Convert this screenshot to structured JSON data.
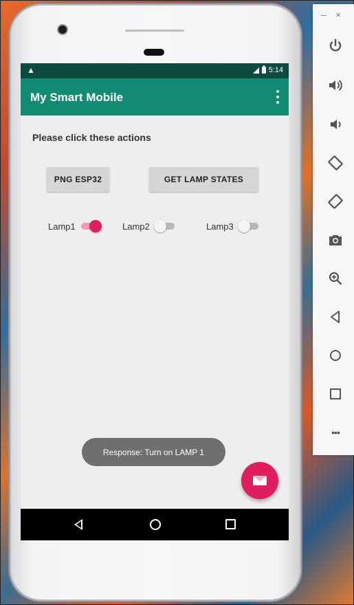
{
  "app": {
    "title": "My Smart Mobile",
    "status_time": "5:14",
    "status_alert": "▲"
  },
  "main": {
    "prompt": "Please click these actions",
    "buttons": {
      "ping_label": "PNG ESP32",
      "get_states_label": "GET LAMP STATES"
    },
    "lamps": [
      {
        "label": "Lamp1",
        "on": true
      },
      {
        "label": "Lamp2",
        "on": false
      },
      {
        "label": "Lamp3",
        "on": false
      }
    ]
  },
  "toast": "Response: Turn on LAMP 1",
  "emulator_panel": {
    "minimize": "–",
    "close": "×",
    "more": "•••",
    "tools": [
      "power-icon",
      "volume-up-icon",
      "volume-down-icon",
      "rotate-left-icon",
      "rotate-right-icon",
      "camera-icon",
      "zoom-icon",
      "back-icon",
      "home-icon",
      "overview-icon"
    ]
  },
  "colors": {
    "statusbar": "#0e4a3f",
    "appbar": "#128b73",
    "accent": "#e01d5d",
    "screen_bg": "#eeeeee"
  }
}
